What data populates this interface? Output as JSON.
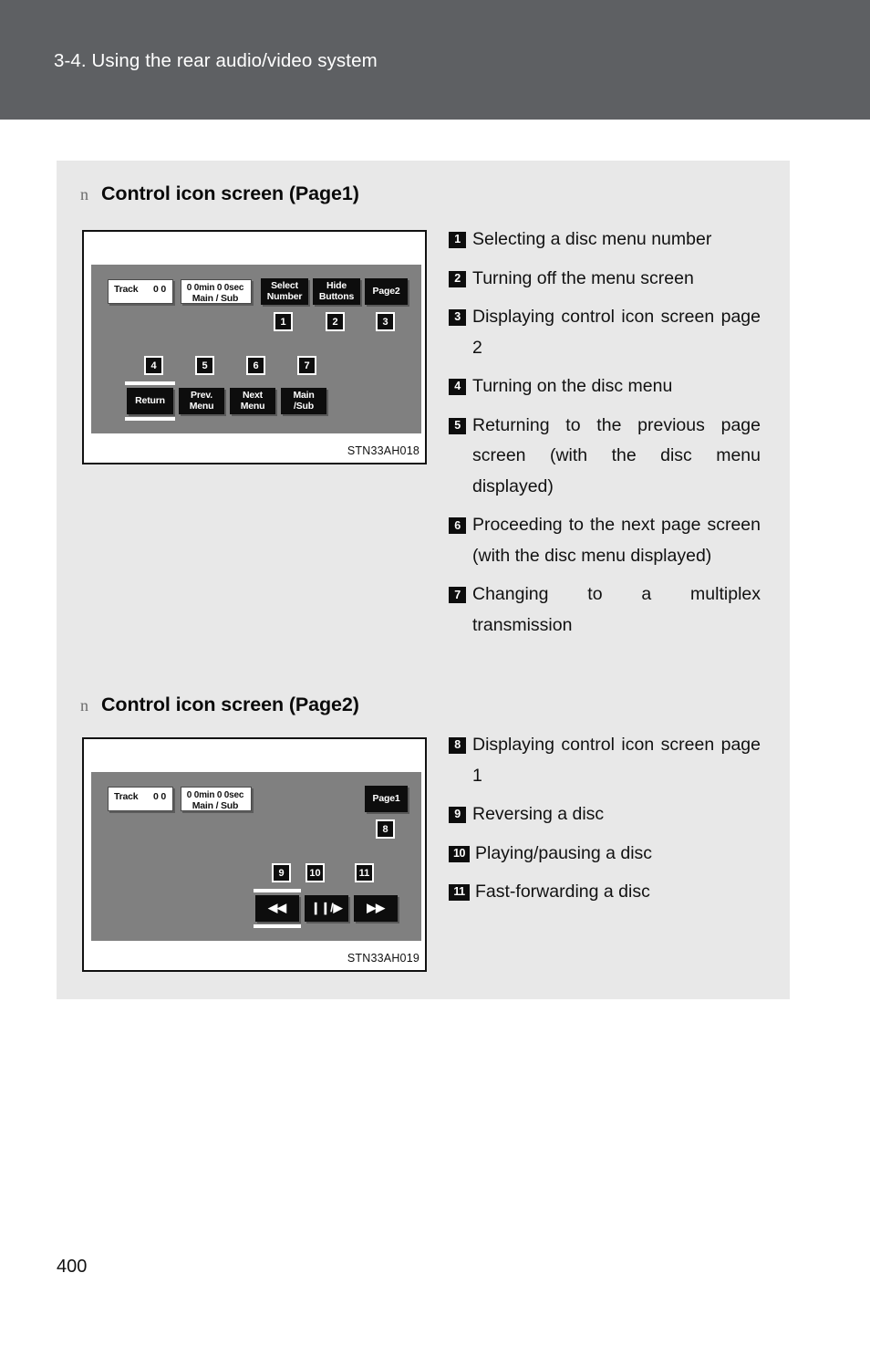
{
  "header": {
    "title": "3-4. Using the rear audio/video system"
  },
  "page_number": "400",
  "sections": [
    {
      "bullet": "n",
      "heading": "Control icon screen (Page1)",
      "figure": {
        "caption": "STN33AH018",
        "display": {
          "track_label": "Track",
          "track_value": "0 0",
          "time_line1": "0 0min 0 0sec",
          "time_line2": "Main / Sub"
        },
        "buttons": [
          {
            "line1": "Select",
            "line2": "Number",
            "callout": "1"
          },
          {
            "line1": "Hide",
            "line2": "Buttons",
            "callout": "2"
          },
          {
            "line1": "Page2",
            "line2": "",
            "callout": "3"
          },
          {
            "line1": "Return",
            "line2": "",
            "callout": "4"
          },
          {
            "line1": "Prev.",
            "line2": "Menu",
            "callout": "5"
          },
          {
            "line1": "Next",
            "line2": "Menu",
            "callout": "6"
          },
          {
            "line1": "Main",
            "line2": "/Sub",
            "callout": "7"
          }
        ]
      },
      "legend": [
        {
          "num": "1",
          "text": "Selecting a disc menu number"
        },
        {
          "num": "2",
          "text": "Turning off the menu screen"
        },
        {
          "num": "3",
          "text": "Displaying control icon screen page 2"
        },
        {
          "num": "4",
          "text": "Turning on the disc menu"
        },
        {
          "num": "5",
          "text": "Returning to the previous page screen (with the disc menu displayed)"
        },
        {
          "num": "6",
          "text": "Proceeding to the next page screen (with the disc menu displayed)"
        },
        {
          "num": "7",
          "text": "Changing to a multiplex transmission"
        }
      ]
    },
    {
      "bullet": "n",
      "heading": "Control icon screen (Page2)",
      "figure": {
        "caption": "STN33AH019",
        "display": {
          "track_label": "Track",
          "track_value": "0 0",
          "time_line1": "0 0min 0 0sec",
          "time_line2": "Main / Sub"
        },
        "buttons": [
          {
            "line1": "Page1",
            "line2": "",
            "callout": "8"
          },
          {
            "line1": "◀◀",
            "line2": "",
            "callout": "9"
          },
          {
            "line1": "❙❙/▶",
            "line2": "",
            "callout": "10"
          },
          {
            "line1": "▶▶",
            "line2": "",
            "callout": "11"
          }
        ]
      },
      "legend": [
        {
          "num": "8",
          "text": "Displaying control icon screen page 1"
        },
        {
          "num": "9",
          "text": "Reversing a disc"
        },
        {
          "num": "10",
          "text": "Playing/pausing a disc"
        },
        {
          "num": "11",
          "text": "Fast-forwarding a disc"
        }
      ]
    }
  ]
}
